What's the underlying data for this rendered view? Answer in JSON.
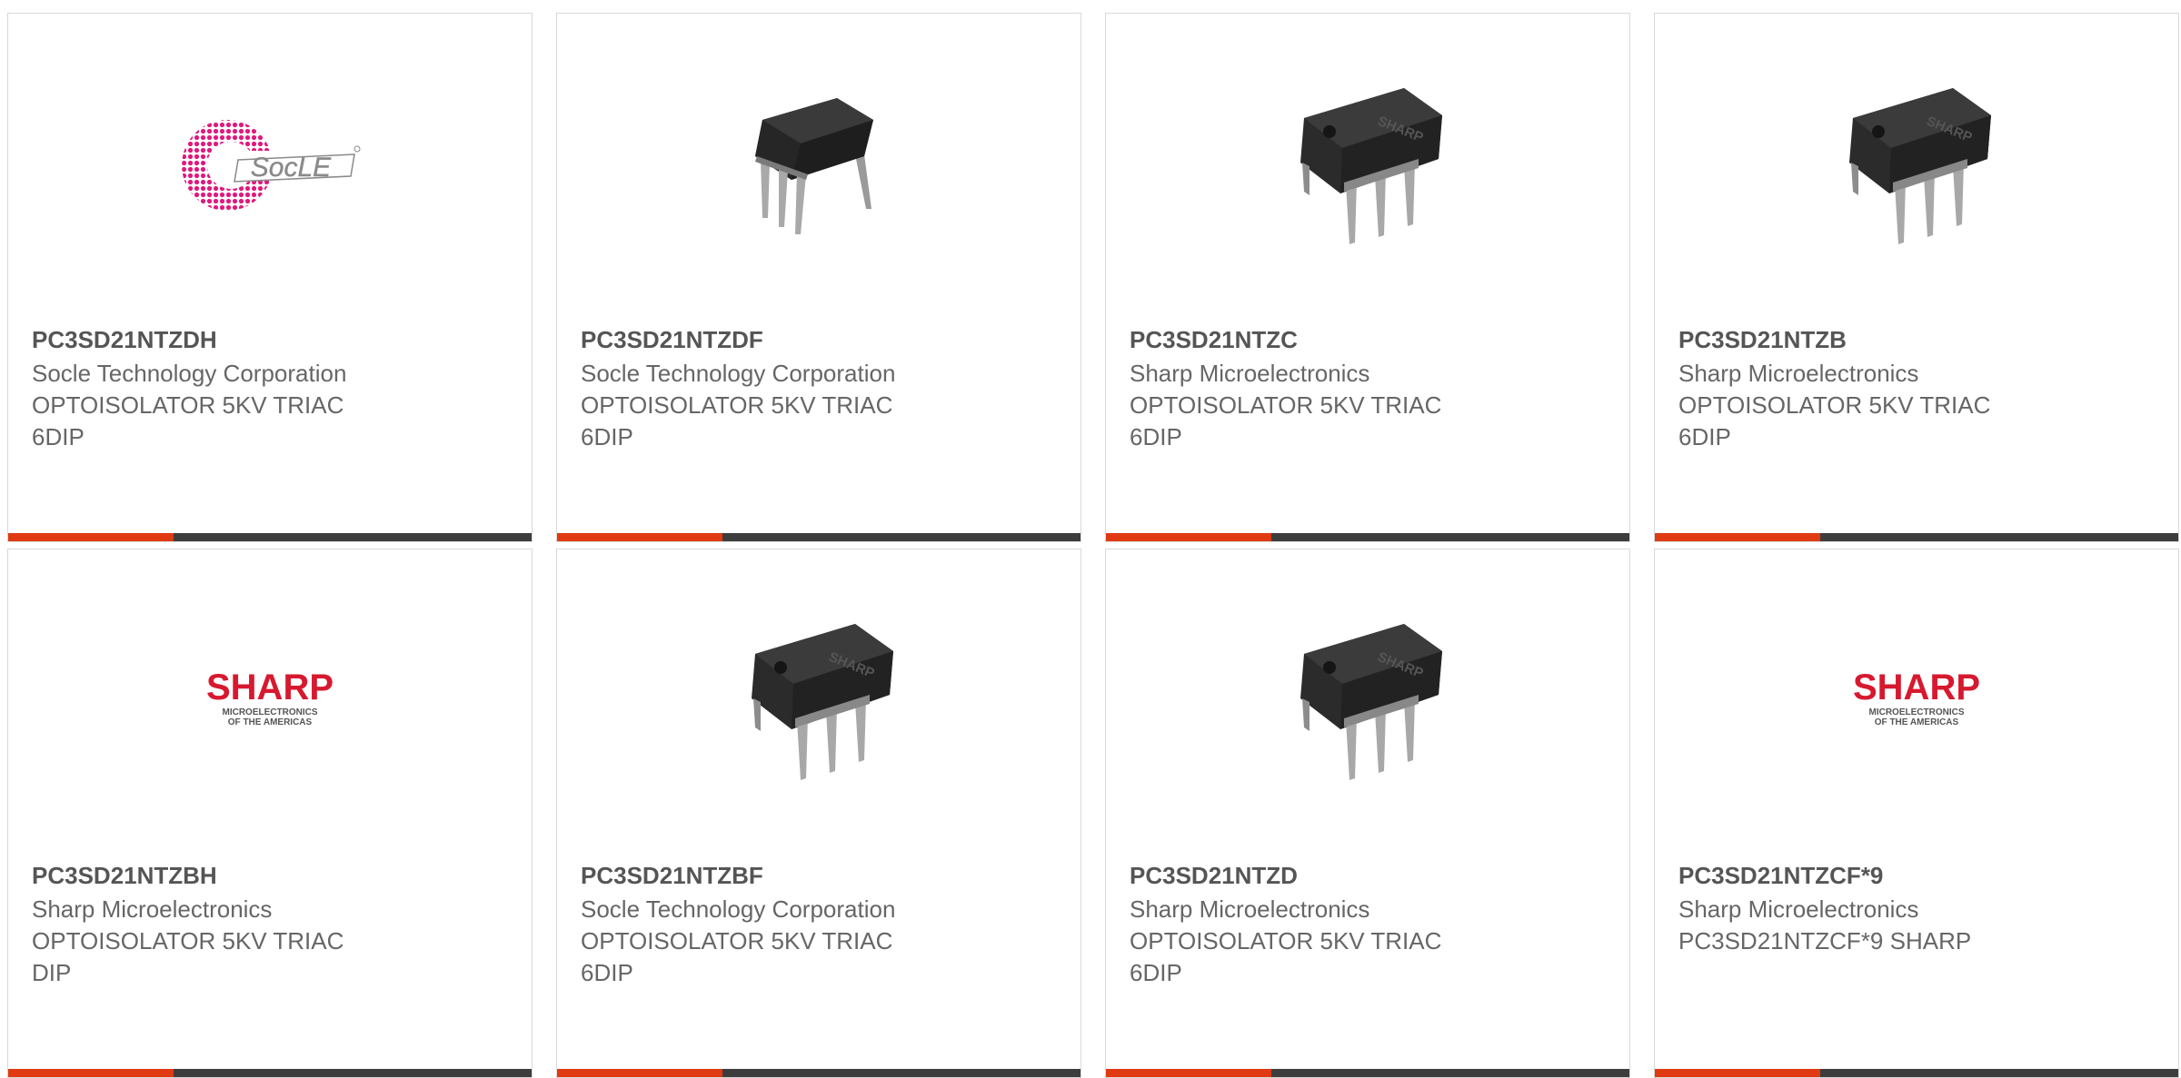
{
  "cards": [
    {
      "part_number": "PC3SD21NTZDH",
      "manufacturer": "Socle Technology Corporation",
      "description_line1": "OPTOISOLATOR 5KV TRIAC",
      "description_line2": "6DIP",
      "image": "socle-logo",
      "logo_text": "SocLE"
    },
    {
      "part_number": "PC3SD21NTZDF",
      "manufacturer": "Socle Technology Corporation",
      "description_line1": "OPTOISOLATOR 5KV TRIAC",
      "description_line2": "6DIP",
      "image": "6dip-chip-side"
    },
    {
      "part_number": "PC3SD21NTZC",
      "manufacturer": "Sharp Microelectronics",
      "description_line1": "OPTOISOLATOR 5KV TRIAC",
      "description_line2": "6DIP",
      "image": "6dip-chip",
      "chip_text": "SHARP"
    },
    {
      "part_number": "PC3SD21NTZB",
      "manufacturer": "Sharp Microelectronics",
      "description_line1": "OPTOISOLATOR 5KV TRIAC",
      "description_line2": "6DIP",
      "image": "6dip-chip",
      "chip_text": "SHARP"
    },
    {
      "part_number": "PC3SD21NTZBH",
      "manufacturer": "Sharp Microelectronics",
      "description_line1": "OPTOISOLATOR 5KV TRIAC",
      "description_line2": "DIP",
      "image": "sharp-logo",
      "logo_text": "SHARP",
      "logo_sub1": "MICROELECTRONICS",
      "logo_sub2": "OF THE AMERICAS"
    },
    {
      "part_number": "PC3SD21NTZBF",
      "manufacturer": "Socle Technology Corporation",
      "description_line1": "OPTOISOLATOR 5KV TRIAC",
      "description_line2": "6DIP",
      "image": "6dip-chip",
      "chip_text": "SHARP"
    },
    {
      "part_number": "PC3SD21NTZD",
      "manufacturer": "Sharp Microelectronics",
      "description_line1": "OPTOISOLATOR 5KV TRIAC",
      "description_line2": "6DIP",
      "image": "6dip-chip",
      "chip_text": "SHARP"
    },
    {
      "part_number": "PC3SD21NTZCF*9",
      "manufacturer": "Sharp Microelectronics",
      "description_line1": "PC3SD21NTZCF*9 SHARP",
      "description_line2": "",
      "image": "sharp-logo",
      "logo_text": "SHARP",
      "logo_sub1": "MICROELECTRONICS",
      "logo_sub2": "OF THE AMERICAS"
    }
  ],
  "colors": {
    "accent": "#e03a12",
    "bar_dark": "#3d3d3d",
    "sharp_red": "#d7192f",
    "socle_pink": "#e0197d"
  }
}
